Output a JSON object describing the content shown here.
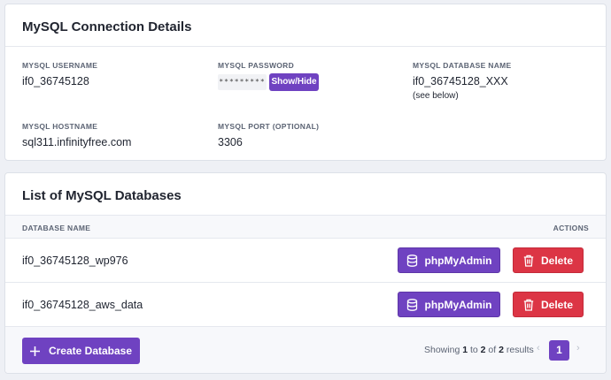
{
  "connection": {
    "title": "MySQL Connection Details",
    "username_label": "MYSQL USERNAME",
    "username": "if0_36745128",
    "password_label": "MYSQL PASSWORD",
    "password_mask": "*********",
    "show_hide_label": "Show/Hide",
    "dbname_label": "MYSQL DATABASE NAME",
    "dbname": "if0_36745128_XXX",
    "dbname_note": "(see below)",
    "hostname_label": "MYSQL HOSTNAME",
    "hostname": "sql311.infinityfree.com",
    "port_label": "MYSQL PORT (OPTIONAL)",
    "port": "3306"
  },
  "databases": {
    "title": "List of MySQL Databases",
    "col_name": "DATABASE NAME",
    "col_actions": "ACTIONS",
    "rows": [
      {
        "name": "if0_36745128_wp976",
        "pma_label": "phpMyAdmin",
        "delete_label": "Delete"
      },
      {
        "name": "if0_36745128_aws_data",
        "pma_label": "phpMyAdmin",
        "delete_label": "Delete"
      }
    ],
    "create_label": "Create Database",
    "pagination": {
      "showing_prefix": "Showing",
      "from": "1",
      "to_word": "to",
      "to": "2",
      "of_word": "of",
      "total": "2",
      "results_word": "results",
      "prev": "‹",
      "page": "1",
      "next": "›"
    }
  },
  "colors": {
    "primary": "#6f42c1",
    "danger": "#dc3545",
    "background": "#eef0f5"
  },
  "icons": {
    "show_hide": "none",
    "phpmyadmin": "database-icon",
    "delete": "trash-icon",
    "create": "plus-icon"
  }
}
